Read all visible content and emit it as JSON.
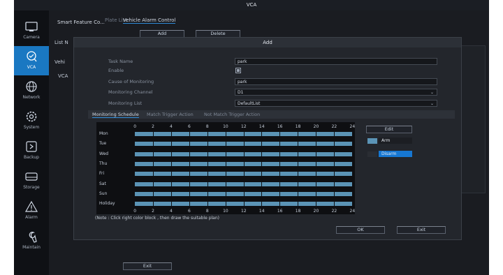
{
  "app": {
    "title": "VCA"
  },
  "sidebar": {
    "items": [
      {
        "label": "Camera",
        "icon": "camera-icon",
        "active": false
      },
      {
        "label": "VCA",
        "icon": "vca-icon",
        "active": true
      },
      {
        "label": "Network",
        "icon": "network-icon",
        "active": false
      },
      {
        "label": "System",
        "icon": "gear-icon",
        "active": false
      },
      {
        "label": "Backup",
        "icon": "backup-icon",
        "active": false
      },
      {
        "label": "Storage",
        "icon": "storage-icon",
        "active": false
      },
      {
        "label": "Alarm",
        "icon": "alarm-icon",
        "active": false
      },
      {
        "label": "Maintain",
        "icon": "wrench-icon",
        "active": false
      }
    ]
  },
  "main": {
    "section_title": "Smart Feature Co...",
    "tabs": [
      "Plate List",
      "Vehicle Alarm Control"
    ],
    "add_label": "Add",
    "delete_label": "Delete",
    "left_items": [
      "List N",
      "Vehi",
      "VCA"
    ],
    "exit_label": "Exit"
  },
  "dialog": {
    "title": "Add",
    "fields": {
      "task_name": {
        "label": "Task Name",
        "value": "park"
      },
      "enable": {
        "label": "Enable",
        "checked": true
      },
      "cause": {
        "label": "Cause of Monitoring",
        "value": "park"
      },
      "channel": {
        "label": "Monitoring Channel",
        "value": "D1"
      },
      "list": {
        "label": "Monitoring List",
        "value": "DefaultList"
      }
    },
    "tabs": [
      "Monitoring Schedule",
      "Match Trigger Action",
      "Not Match Trigger Action"
    ],
    "schedule": {
      "hours": [
        "0",
        "2",
        "4",
        "6",
        "8",
        "10",
        "12",
        "14",
        "16",
        "18",
        "20",
        "22",
        "24"
      ],
      "days": [
        "Mon",
        "Tue",
        "Wed",
        "Thu",
        "Fri",
        "Sat",
        "Sun",
        "Holiday"
      ],
      "armed": [
        1,
        1,
        1,
        1,
        1,
        1,
        1,
        1
      ]
    },
    "edit_label": "Edit",
    "legend": {
      "arm": "Arm",
      "disarm": "Disarm",
      "arm_color": "#5b94b6",
      "disarm_color": "#2a2d33",
      "disarm_highlight": "#1677d2"
    },
    "note": "(Note : Click right color block , then draw the suitable plan)",
    "ok_label": "OK",
    "exit_label": "Exit"
  }
}
